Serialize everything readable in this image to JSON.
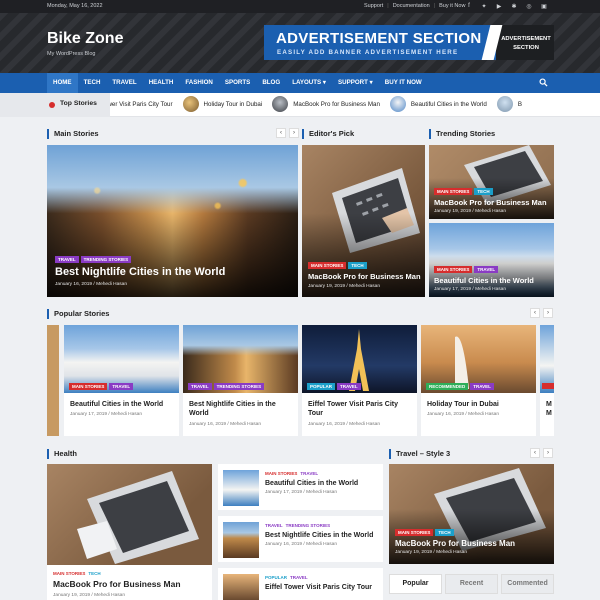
{
  "topbar": {
    "date": "Monday, May 16, 2022",
    "links": [
      "Support",
      "Documentation",
      "Buy it Now"
    ],
    "social_icons": [
      "facebook-icon",
      "twitter-icon",
      "youtube-icon",
      "pinterest-icon",
      "instagram-icon",
      "linkedin-icon"
    ]
  },
  "header": {
    "site_title": "Bike Zone",
    "tagline": "My WordPress Blog"
  },
  "ad": {
    "title": "ADVERTISEMENT SECTION",
    "subtitle": "EASILY ADD BANNER ADVERTISEMENT HERE",
    "side_line1": "ADVERTISEMENT",
    "side_line2": "SECTION"
  },
  "nav": {
    "items": [
      "HOME",
      "TECH",
      "TRAVEL",
      "HEALTH",
      "FASHION",
      "SPORTS",
      "BLOG",
      "LAYOUTS ▾",
      "SUPPORT ▾",
      "BUY IT NOW"
    ],
    "search_icon": "search-icon"
  },
  "ticker": {
    "label": "Top Stories",
    "items": [
      "ower Visit Paris City Tour",
      "Holiday Tour in Dubai",
      "MacBook Pro for Business Man",
      "Beautiful Cities in the World",
      "B"
    ]
  },
  "main_stories": {
    "title": "Main Stories",
    "card": {
      "badges": [
        "TRAVEL",
        "TRENDING STORIES"
      ],
      "title": "Best Nightlife Cities in the World",
      "meta": "January 16, 2019 / Mehedi Hasan"
    }
  },
  "editors_pick": {
    "title": "Editor's Pick",
    "card": {
      "badges": [
        "MAIN STORIES",
        "TECH"
      ],
      "title": "MacBook Pro for Business Man",
      "meta": "January 19, 2019 / Mehedi Hasan"
    }
  },
  "trending": {
    "title": "Trending Stories",
    "cards": [
      {
        "badges": [
          "MAIN STORIES",
          "TECH"
        ],
        "title": "MacBook Pro for Business Man",
        "meta": "January 19, 2019 / Mehedi Hasan"
      },
      {
        "badges": [
          "MAIN STORIES",
          "TRAVEL"
        ],
        "title": "Beautiful Cities in the World",
        "meta": "January 17, 2019 / Mehedi Hasan"
      }
    ]
  },
  "popular": {
    "title": "Popular Stories",
    "cards": [
      {
        "badges": [
          "MAIN STORIES",
          "TRAVEL"
        ],
        "title": "Beautiful Cities in the World",
        "meta": "January 17, 2019 / Mehedi Hasan"
      },
      {
        "badges": [
          "TRAVEL",
          "TRENDING STORIES"
        ],
        "title": "Best Nightlife Cities in the World",
        "meta": "January 16, 2019 / Mehedi Hasan"
      },
      {
        "badges": [
          "POPULAR",
          "TRAVEL"
        ],
        "title": "Eiffel Tower Visit Paris City Tour",
        "meta": "January 16, 2019 / Mehedi Hasan"
      },
      {
        "badges": [
          "RECOMMENDED",
          "TRAVEL"
        ],
        "title": "Holiday Tour in Dubai",
        "meta": "January 16, 2019 / Mehedi Hasan"
      }
    ],
    "edge_right_title": "M\nM"
  },
  "health": {
    "title": "Health",
    "big": {
      "badges": [
        "MAIN STORIES",
        "TECH"
      ],
      "title": "MacBook Pro for Business Man",
      "meta": "January 19, 2019 / Mehedi Hasan"
    },
    "list": [
      {
        "badges": [
          "MAIN STORIES",
          "TRAVEL"
        ],
        "title": "Beautiful Cities in the World",
        "meta": "January 17, 2019 / Mehedi Hasan"
      },
      {
        "badges": [
          "TRAVEL",
          "TRENDING STORIES"
        ],
        "title": "Best Nightlife Cities in the World",
        "meta": "January 16, 2019 / Mehedi Hasan"
      },
      {
        "badges": [
          "POPULAR",
          "TRAVEL"
        ],
        "title": "Eiffel Tower Visit Paris City Tour",
        "meta": ""
      }
    ]
  },
  "travel_style3": {
    "title": "Travel – Style 3",
    "card": {
      "badges": [
        "MAIN STORIES",
        "TECH"
      ],
      "title": "MacBook Pro for Business Man",
      "meta": "January 19, 2019 / Mehedi Hasan"
    },
    "tabs": [
      "Popular",
      "Recent",
      "Commented"
    ]
  },
  "colors": {
    "accent": "#1b5fb0",
    "red": "#d62d2d",
    "purple": "#8a3bc4",
    "teal": "#1b9fc9",
    "green": "#2eae59"
  }
}
